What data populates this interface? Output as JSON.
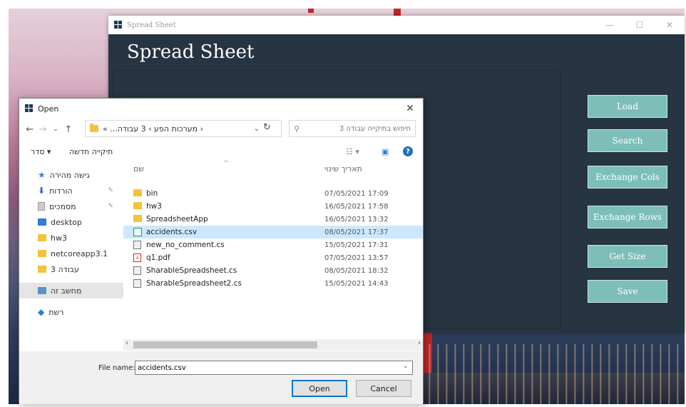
{
  "app": {
    "window_title": "Spread Sheet",
    "heading": "Spread Sheet",
    "buttons": [
      "Load",
      "Search",
      "Exchange Cols",
      "Exchange Rows",
      "Get Size",
      "Save"
    ]
  },
  "dialog": {
    "title": "Open",
    "breadcrumb": "« ...מערכות הפע › 3 עבודה ›",
    "search_placeholder": "חיפוש בתיקייה עבודה 3",
    "organize_label": "סדר ▾",
    "new_folder_label": "תיקייה חדשה",
    "nav_items": [
      {
        "label": "גישה מהירה",
        "icon": "star-icon"
      },
      {
        "label": "הורדות",
        "icon": "download-icon"
      },
      {
        "label": "מסמכים",
        "icon": "documents-icon"
      },
      {
        "label": "desktop",
        "icon": "desktop-icon"
      },
      {
        "label": "hw3",
        "icon": "folder-icon"
      },
      {
        "label": "netcoreapp3.1",
        "icon": "folder-icon"
      },
      {
        "label": "עבודה 3",
        "icon": "folder-icon"
      },
      {
        "label": "מחשב זה",
        "icon": "computer-icon"
      },
      {
        "label": "רשת",
        "icon": "network-icon"
      }
    ],
    "columns": {
      "name": "שם",
      "date": "תאריך שינוי"
    },
    "files": [
      {
        "name": "bin",
        "date": "07/05/2021 17:09",
        "type": "folder"
      },
      {
        "name": "hw3",
        "date": "16/05/2021 17:58",
        "type": "folder"
      },
      {
        "name": "SpreadsheetApp",
        "date": "16/05/2021 13:32",
        "type": "folder"
      },
      {
        "name": "accidents.csv",
        "date": "08/05/2021 17:37",
        "type": "csv"
      },
      {
        "name": "new_no_comment.cs",
        "date": "15/05/2021 17:31",
        "type": "cs"
      },
      {
        "name": "q1.pdf",
        "date": "07/05/2021 13:57",
        "type": "pdf"
      },
      {
        "name": "SharableSpreadsheet.cs",
        "date": "08/05/2021 18:32",
        "type": "cs"
      },
      {
        "name": "SharableSpreadsheet2.cs",
        "date": "15/05/2021 14:43",
        "type": "cs"
      }
    ],
    "file_name_label": "File name:",
    "file_name_value": "accidents.csv",
    "open_label": "Open",
    "cancel_label": "Cancel"
  }
}
